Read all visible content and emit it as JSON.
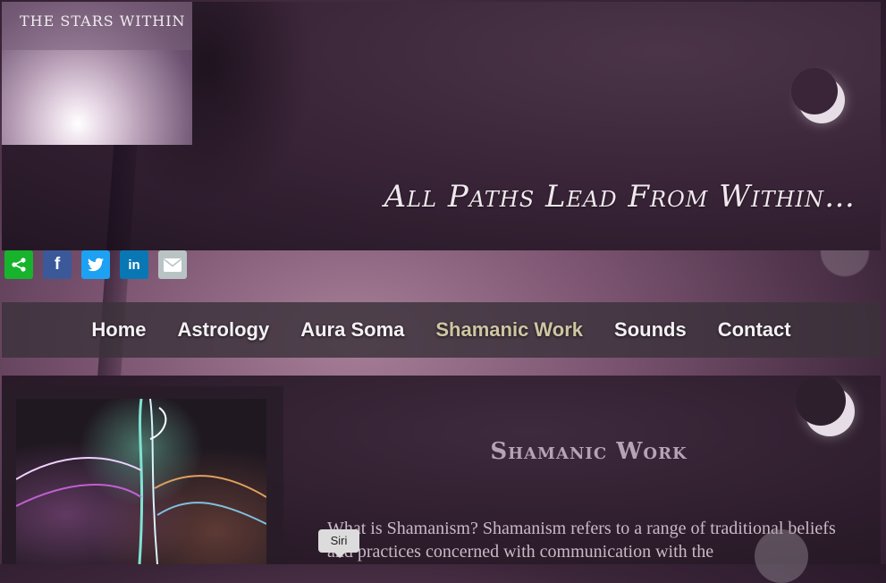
{
  "site": {
    "logo_title": "THE STARS WITHIN",
    "tagline": "All Paths Lead From Within…"
  },
  "share": {
    "buttons": [
      {
        "name": "share",
        "color": "#18b32c"
      },
      {
        "name": "facebook",
        "color": "#3b5998"
      },
      {
        "name": "twitter",
        "color": "#1da1f2"
      },
      {
        "name": "linkedin",
        "color": "#0a77b5"
      },
      {
        "name": "email",
        "color": "#b9c3c4"
      }
    ]
  },
  "nav": {
    "items": [
      {
        "label": "Home"
      },
      {
        "label": "Astrology"
      },
      {
        "label": "Aura Soma"
      },
      {
        "label": "Shamanic Work",
        "active": true
      },
      {
        "label": "Sounds"
      },
      {
        "label": "Contact"
      }
    ],
    "active_color": "#cfc5a2"
  },
  "main": {
    "title": "Shamanic Work",
    "body": "What is Shamanism? Shamanism refers to a range of traditional beliefs and practices concerned with communication with the"
  },
  "tooltip": {
    "label": "Siri"
  }
}
